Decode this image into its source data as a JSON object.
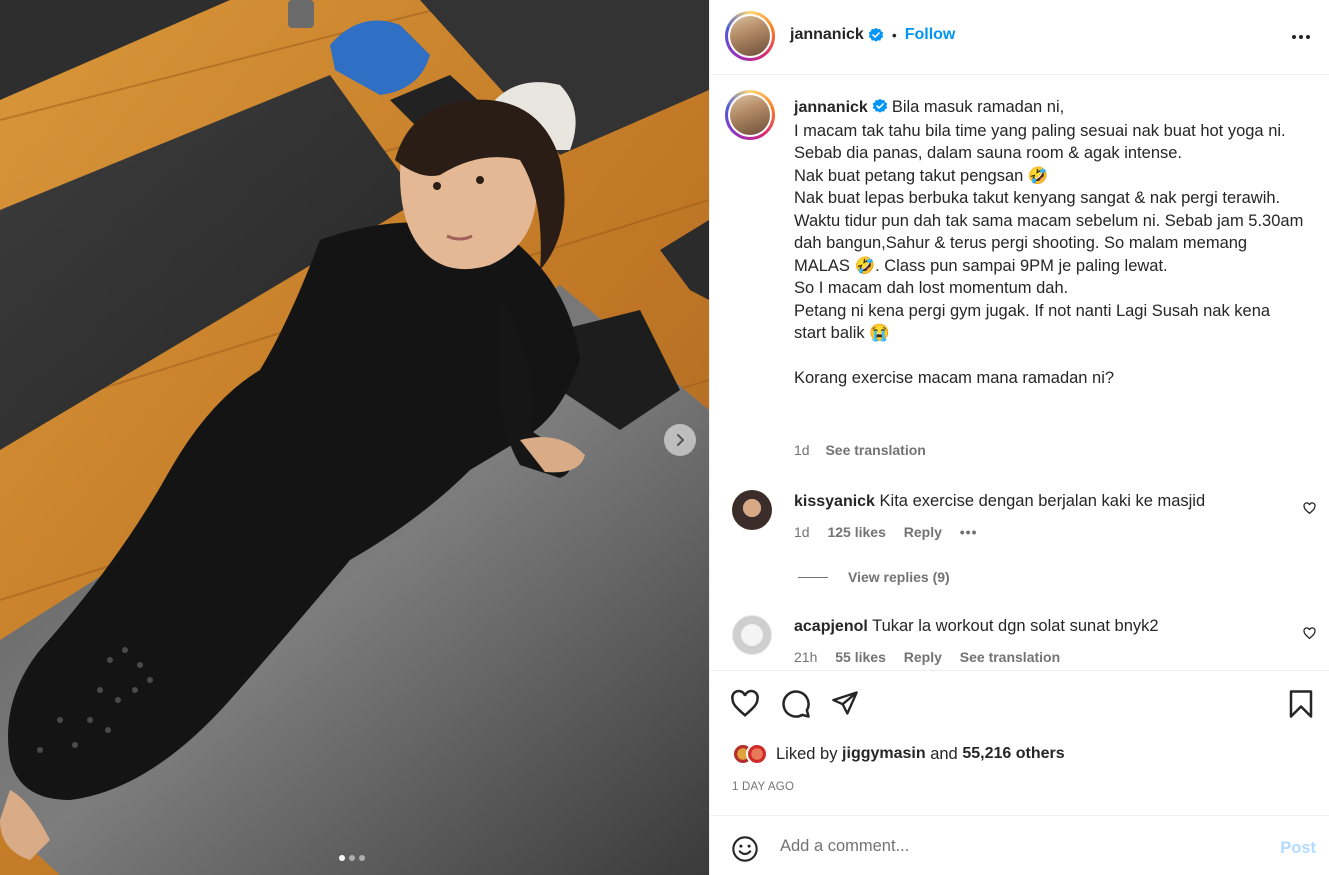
{
  "post": {
    "username": "jannanick",
    "follow_label": "Follow",
    "separator": "•",
    "photo_description_icon": "photo-icon"
  },
  "caption": {
    "username": "jannanick",
    "text": "Bila masuk ramadan ni,\nI macam tak tahu bila time yang paling sesuai nak buat hot yoga ni.\nSebab dia panas, dalam sauna room & agak intense.\nNak buat petang takut pengsan 🤣\nNak buat lepas berbuka takut kenyang sangat & nak pergi terawih.\nWaktu tidur pun dah tak sama macam sebelum ni. Sebab jam 5.30am dah bangun,Sahur & terus pergi shooting. So malam memang MALAS 🤣. Class pun sampai 9PM je paling lewat.\nSo I macam dah lost momentum dah.\nPetang ni kena pergi gym jugak. If not nanti Lagi Susah nak kena start balik 😭\n\nKorang exercise macam mana ramadan ni?",
    "age": "1d",
    "see_translation": "See translation"
  },
  "comments": [
    {
      "username": "kissyanick",
      "text": "Kita exercise dengan berjalan kaki ke masjid",
      "age": "1d",
      "likes": "125 likes",
      "reply": "Reply",
      "more": "•••"
    },
    {
      "username": "acapjenol",
      "text": "Tukar la workout dgn solat sunat bnyk2",
      "age": "21h",
      "likes": "55 likes",
      "reply": "Reply",
      "see_translation": "See translation"
    }
  ],
  "view_replies": "View replies (9)",
  "likes": {
    "prefix": "Liked by ",
    "user": "jiggymasin",
    "middle": " and ",
    "others": "55,216 others"
  },
  "time_ago": "1 DAY AGO",
  "add_comment": {
    "placeholder": "Add a comment...",
    "post_label": "Post"
  },
  "colors": {
    "accent": "#0095f6",
    "post_disabled": "#b3dbff",
    "muted": "#737373"
  },
  "carousel": {
    "count": 3,
    "active_index": 0
  }
}
